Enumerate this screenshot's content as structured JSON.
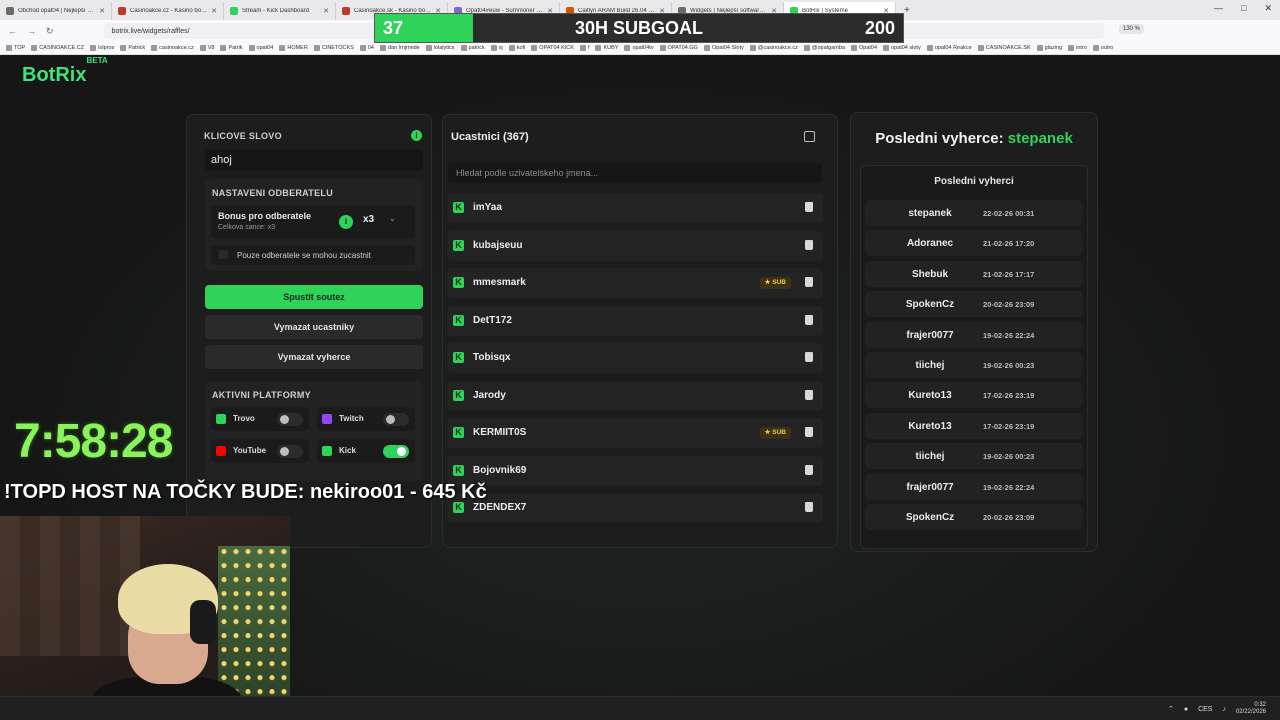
{
  "browser": {
    "tabs": [
      {
        "title": "Obchod opat04 | Nejlepší softw",
        "color": "#6b6b6b"
      },
      {
        "title": "Casinoakce.cz - Kasino bonusy",
        "color": "#c0392b"
      },
      {
        "title": "Stream - Kick Dashboard",
        "color": "#2fd35a"
      },
      {
        "title": "Casinoakce.sk - Kasino bonusy",
        "color": "#c0392b"
      },
      {
        "title": "Opat04#euw - Summoner Sta",
        "color": "#7a6cc9"
      },
      {
        "title": "Caitlyn ARAM Build 26.04 - Run",
        "color": "#d35400"
      },
      {
        "title": "Widgets | Nejlepší software pro",
        "color": "#6b6b6b"
      },
      {
        "title": "BotRix | Systéme",
        "color": "#2fd35a"
      }
    ],
    "url": "botrix.live/widgets/raffles/",
    "zoom": "130 %",
    "bookmarks": [
      "TOP",
      "CASINOAKCE.CZ",
      "lolpros",
      "Patrick",
      "casinoakce.cz",
      "V8",
      "Patrik",
      "opat04",
      "HOMER",
      "CINETOCKS",
      "04",
      "dan lrnjrmide",
      "lolalytics",
      "patrick",
      "sj",
      "kofi",
      "OPAT04 KICK",
      "f",
      "KUBY",
      "opat04tv",
      "OPAT04.GG",
      "Opat04 Sloty",
      "@casinoakce.cz",
      "@opatgamba",
      "Opat04",
      "opat04 sloty",
      "opat04 Reakce",
      "CASINOAKCE.SK",
      "glazing",
      "intro",
      "outro"
    ]
  },
  "subgoal": {
    "current": "37",
    "title": "30H SUBGOAL",
    "goal": "200",
    "progress": 0.185
  },
  "app": {
    "logo": "BotRix",
    "logo_badge": "BETA"
  },
  "settings": {
    "keyword_label": "KLICOVE SLOVO",
    "keyword_value": "ahoj",
    "subs_label": "NASTAVENI ODBERATELU",
    "bonus_title": "Bonus pro odberatele",
    "bonus_sub": "Celkova sance: x3",
    "multiplier": "x3",
    "only_subs_label": "Pouze odberatele se mohou zucastnit",
    "start_button": "Spustit soutez",
    "clear_participants_button": "Vymazat ucastniky",
    "clear_winners_button": "Vymazat vyherce",
    "platforms_label": "AKTIVNI PLATFORMY",
    "platforms": [
      {
        "name": "Trovo",
        "color": "#2fd35a",
        "on": false
      },
      {
        "name": "Twitch",
        "color": "#9146ff",
        "on": false
      },
      {
        "name": "YouTube",
        "color": "#ff0000",
        "on": false
      },
      {
        "name": "Kick",
        "color": "#2fd35a",
        "on": true
      }
    ]
  },
  "participants": {
    "title": "Ucastnici (367)",
    "search_placeholder": "Hledat podle uzivatelskeho jmena...",
    "sub_badge": "★ SUB",
    "items": [
      {
        "name": "imYaa",
        "sub": false
      },
      {
        "name": "kubajseuu",
        "sub": false
      },
      {
        "name": "mmesmark",
        "sub": true
      },
      {
        "name": "DetT172",
        "sub": false
      },
      {
        "name": "Tobisqx",
        "sub": false
      },
      {
        "name": "Jarody",
        "sub": false
      },
      {
        "name": "KERMIIT0S",
        "sub": true
      },
      {
        "name": "Bojovnik69",
        "sub": false
      },
      {
        "name": "ZDENDEX7",
        "sub": false
      }
    ]
  },
  "winners": {
    "title_prefix": "Posledni vyherce:",
    "title_name": "stepanek",
    "list_title": "Posledni vyherci",
    "items": [
      {
        "name": "stepanek",
        "date": "22-02-26 00:31"
      },
      {
        "name": "Adoranec",
        "date": "21-02-26 17:20"
      },
      {
        "name": "Shebuk",
        "date": "21-02-26 17:17"
      },
      {
        "name": "SpokenCz",
        "date": "20-02-26 23:09"
      },
      {
        "name": "frajer0077",
        "date": "19-02-26 22:24"
      },
      {
        "name": "tiichej",
        "date": "19-02-26 00:23"
      },
      {
        "name": "Kureto13",
        "date": "17-02-26 23:19"
      },
      {
        "name": "Kureto13",
        "date": "17-02-26 23:19"
      },
      {
        "name": "tiichej",
        "date": "19-02-26 00:23"
      },
      {
        "name": "frajer0077",
        "date": "19-02-26 22:24"
      },
      {
        "name": "SpokenCz",
        "date": "20-02-26 23:09"
      }
    ]
  },
  "overlay": {
    "timer": "7:58:28",
    "host_text": "!TOPD HOST NA TOČKY BUDE:  nekiroo01 - 645 Kč"
  },
  "taskbar": {
    "lang": "CES",
    "time": "0:32",
    "date": "02/22/2026"
  }
}
